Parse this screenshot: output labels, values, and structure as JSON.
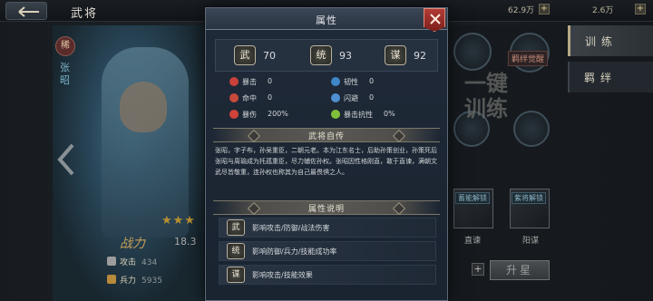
{
  "header": {
    "title": "武将",
    "res_a": "62.9万",
    "res_b": "2.6万",
    "plus": "+"
  },
  "hero": {
    "name": "张昭",
    "badge": "稀",
    "stars": "★★★",
    "power_label": "战力",
    "power_value": "18.3",
    "stats": [
      {
        "label": "攻击",
        "value": "434"
      },
      {
        "label": "兵力",
        "value": "5935"
      }
    ]
  },
  "right_tabs": [
    {
      "label": "训练"
    },
    {
      "label": "羁绊"
    }
  ],
  "right": {
    "emblem_label": "羁绊觉醒",
    "brush_text": "一键训练",
    "skills": [
      {
        "name": "蓄能解锁",
        "caption": "直谏"
      },
      {
        "name": "紫将解锁",
        "caption": "阳谋"
      }
    ],
    "upgrade_label": "升星",
    "plus": "+"
  },
  "modal": {
    "title": "属性",
    "core_attrs": [
      {
        "seal": "武",
        "value": "70"
      },
      {
        "seal": "统",
        "value": "93"
      },
      {
        "seal": "谋",
        "value": "92"
      }
    ],
    "minor_attrs_left": [
      {
        "label": "暴击",
        "value": "0",
        "color": "#c8423b"
      },
      {
        "label": "命中",
        "value": "0",
        "color": "#c84a3c"
      },
      {
        "label": "暴伤",
        "value": "200%",
        "color": "#d0433a"
      }
    ],
    "minor_attrs_right": [
      {
        "label": "韧性",
        "value": "0",
        "color": "#3f86c7"
      },
      {
        "label": "闪避",
        "value": "0",
        "color": "#4f8fd2"
      },
      {
        "label": "暴击抗性",
        "value": "0%",
        "color": "#7fbf3a"
      }
    ],
    "bio_title": "武将自传",
    "bio_text": "张昭，字子布，孙吴重臣，二朝元老。本为江东名士，后助孙策创业，孙策死后张昭与周瑜成为托孤重臣，尽力辅佐孙权。张昭因性格刚直，敢于直谏，满朝文武尽皆敬重，连孙权也称其为自己最畏惧之人。",
    "explain_title": "属性说明",
    "explanations": [
      {
        "seal": "武",
        "text": "影响攻击/防御/战法伤害"
      },
      {
        "seal": "统",
        "text": "影响防御/兵力/技能成功率"
      },
      {
        "seal": "谋",
        "text": "影响攻击/技能效果"
      }
    ]
  }
}
